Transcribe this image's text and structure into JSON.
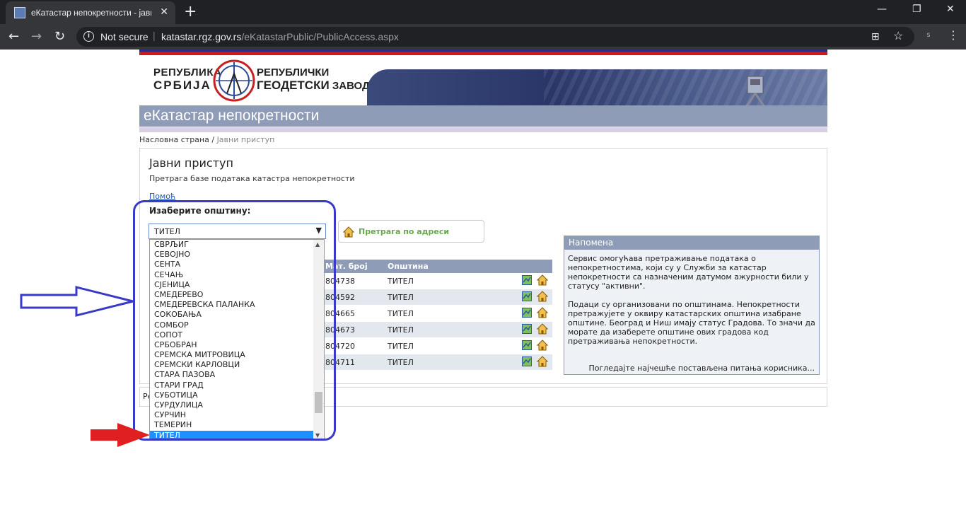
{
  "browser": {
    "tab_title": "еКатастар непокретности - јавни",
    "tab_close": "✕",
    "new_tab": "+",
    "minimize": "—",
    "restore": "❐",
    "close": "✕",
    "back": "←",
    "forward": "→",
    "reload": "↻",
    "info_icon": "i",
    "security_label": "Not secure",
    "separator": "|",
    "url_host": "katastar.rgz.gov.rs",
    "url_path": "/eKatastarPublic/PublicAccess.aspx",
    "translate_icon": "⊞",
    "star_icon": "☆",
    "ext_icon": "s",
    "menu_icon": "⋮"
  },
  "header": {
    "left_logo_line1": "РЕПУБЛИКА",
    "left_logo_line2": "СРБИЈА",
    "right_logo_line1": "РЕПУБЛИЧКИ",
    "right_logo_line2": "ГЕОДЕТСКИ",
    "right_logo_line3": "ЗАВОД",
    "site_title": "еКатастар непокретности"
  },
  "breadcrumb": {
    "home": "Насловна страна",
    "sep": " / ",
    "current": "Јавни приступ"
  },
  "main": {
    "title": "Јавни приступ",
    "subtitle": "Претрага базе података катастра непокретности",
    "help": "Помоћ",
    "choose_label": "Изаберите општину:",
    "selected_municipality": "ТИТЕЛ",
    "select_arrow": "▼",
    "address_search": "Претрага по адреси"
  },
  "table": {
    "col_id": "Мат. број",
    "col_municipality": "Општина",
    "rows": [
      {
        "id": "804738",
        "municipality": "ТИТЕЛ"
      },
      {
        "id": "804592",
        "municipality": "ТИТЕЛ"
      },
      {
        "id": "804665",
        "municipality": "ТИТЕЛ"
      },
      {
        "id": "804673",
        "municipality": "ТИТЕЛ"
      },
      {
        "id": "804720",
        "municipality": "ТИТЕЛ"
      },
      {
        "id": "804711",
        "municipality": "ТИТЕЛ"
      }
    ]
  },
  "dropdown": {
    "items": [
      "СВРЉИГ",
      "СЕВОЈНО",
      "СЕНТА",
      "СЕЧАЊ",
      "СЈЕНИЦА",
      "СМЕДЕРЕВО",
      "СМЕДЕРЕВСКА ПАЛАНКА",
      "СОКОБАЊА",
      "СОМБОР",
      "СОПОТ",
      "СРБОБРАН",
      "СРЕМСКА МИТРОВИЦА",
      "СРЕМСКИ КАРЛОВЦИ",
      "СТАРА ПАЗОВА",
      "СТАРИ ГРАД",
      "СУБОТИЦА",
      "СУРДУЛИЦА",
      "СУРЧИН",
      "ТЕМЕРИН",
      "ТИТЕЛ"
    ],
    "selected": "ТИТЕЛ",
    "scroll_up": "▲",
    "scroll_down": "▼"
  },
  "note": {
    "title": "Напомена",
    "p1": "Сервис омогућава претраживање података о непокретностима, који су у Служби за катастар непокретности са назначеним датумом ажурности били у статусу \"активни\".",
    "p2": "Подаци су организовани по општинама. Непокретности претражујете у оквиру катастарских општина изабране општине. Београд и Ниш имају статус Градова. То значи да морате да изаберете општине ових градова код претраживања непокретности.",
    "faq_link": "Погледајте најчешће постављена питања корисника..."
  },
  "footer": {
    "text": "Ре"
  },
  "colors": {
    "accent": "#8e9cb7",
    "annotation_blue": "#3a3ac8",
    "annotation_red": "#e02020"
  }
}
